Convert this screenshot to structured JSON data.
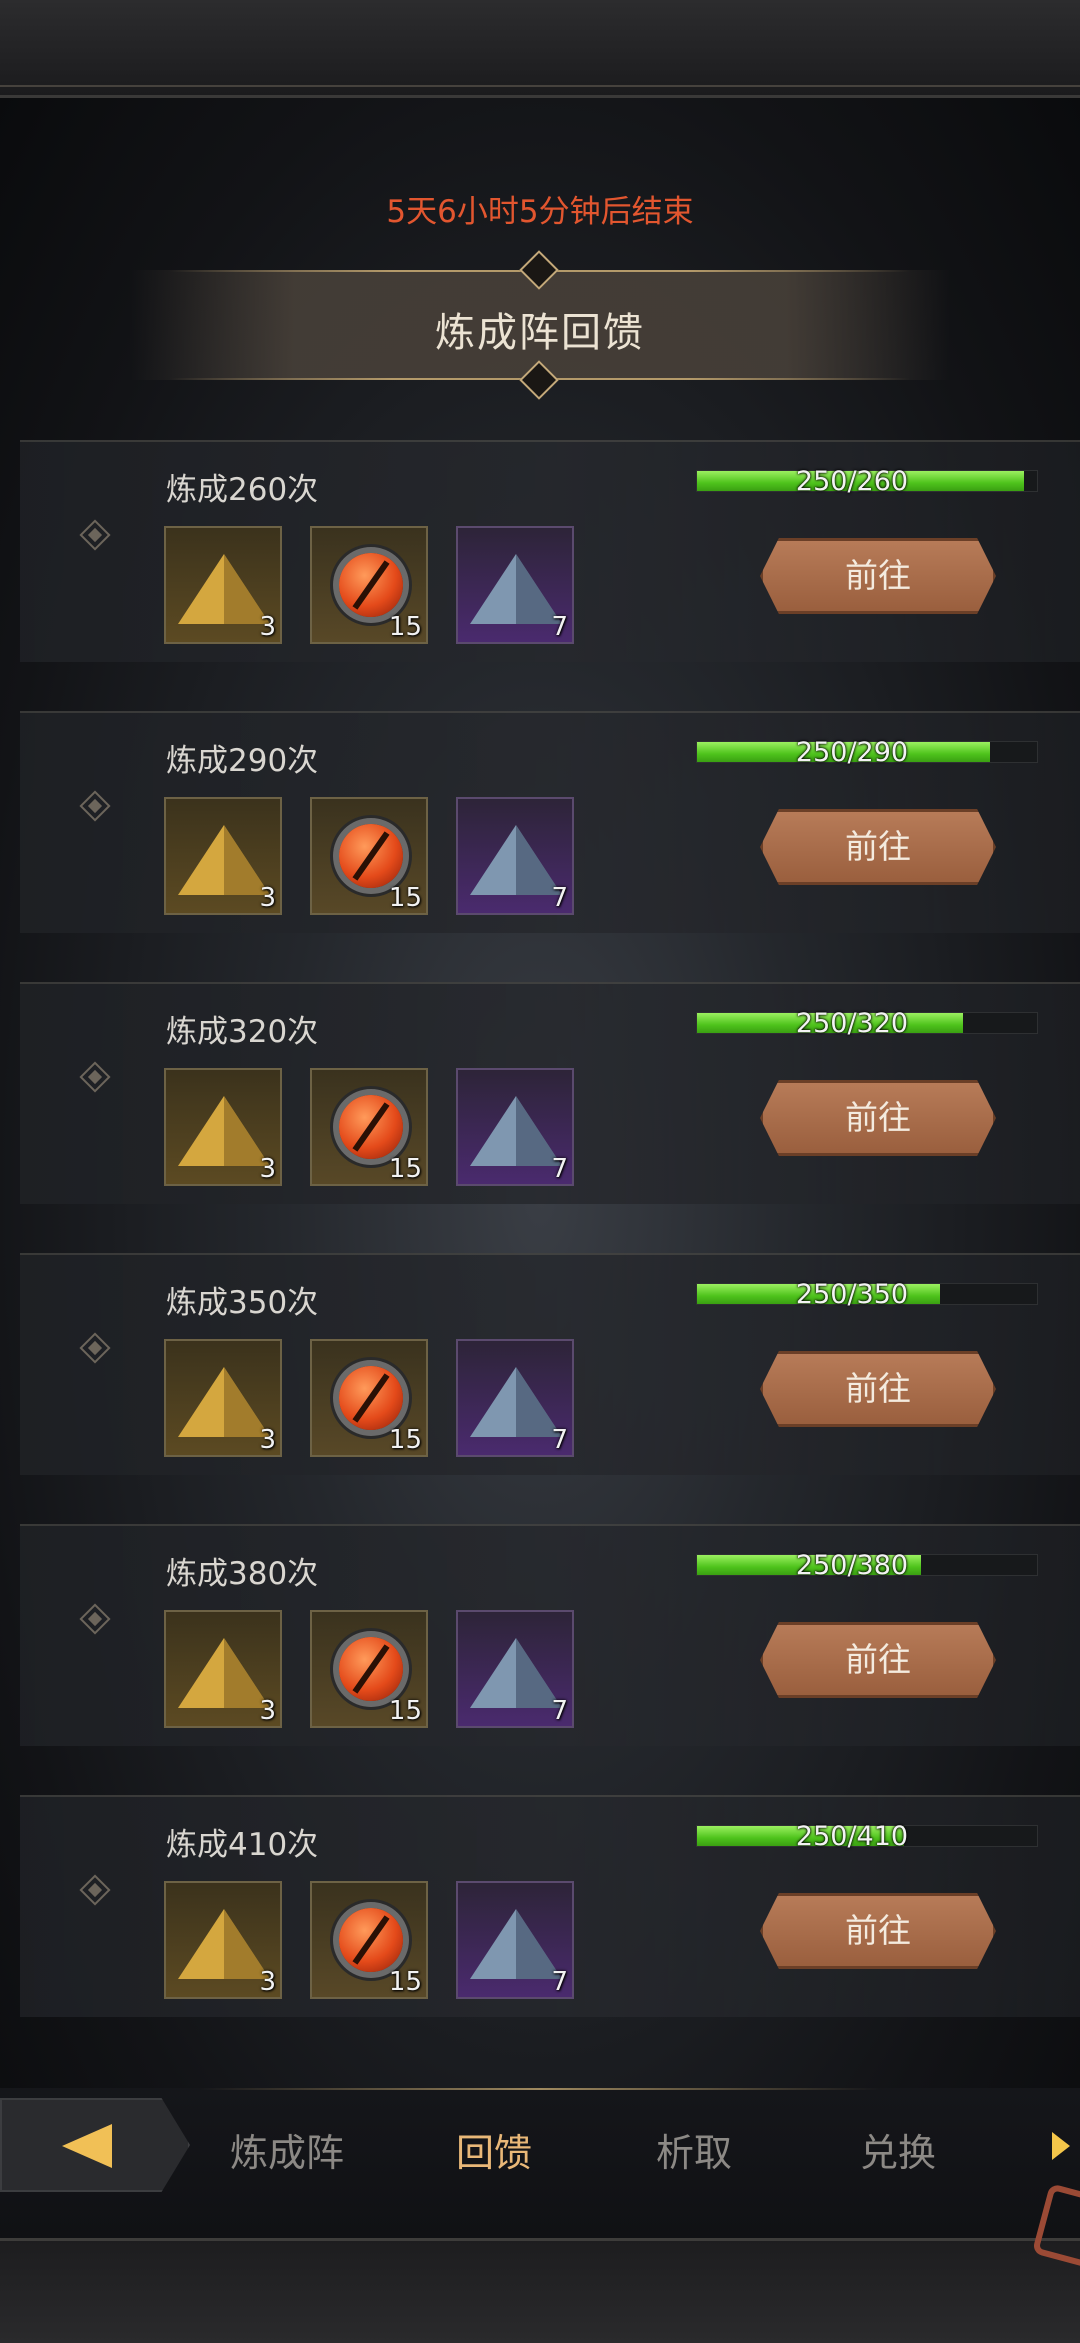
{
  "timer_text": "5天6小时5分钟后结束",
  "banner_title": "炼成阵回馈",
  "rows": [
    {
      "label": "炼成260次",
      "current": 250,
      "total": 260,
      "progress_text": "250/260",
      "button_label": "前往",
      "rewards": [
        {
          "type": "gold",
          "count": "3"
        },
        {
          "type": "red",
          "count": "15"
        },
        {
          "type": "purple",
          "count": "7"
        }
      ]
    },
    {
      "label": "炼成290次",
      "current": 250,
      "total": 290,
      "progress_text": "250/290",
      "button_label": "前往",
      "rewards": [
        {
          "type": "gold",
          "count": "3"
        },
        {
          "type": "red",
          "count": "15"
        },
        {
          "type": "purple",
          "count": "7"
        }
      ]
    },
    {
      "label": "炼成320次",
      "current": 250,
      "total": 320,
      "progress_text": "250/320",
      "button_label": "前往",
      "rewards": [
        {
          "type": "gold",
          "count": "3"
        },
        {
          "type": "red",
          "count": "15"
        },
        {
          "type": "purple",
          "count": "7"
        }
      ]
    },
    {
      "label": "炼成350次",
      "current": 250,
      "total": 350,
      "progress_text": "250/350",
      "button_label": "前往",
      "rewards": [
        {
          "type": "gold",
          "count": "3"
        },
        {
          "type": "red",
          "count": "15"
        },
        {
          "type": "purple",
          "count": "7"
        }
      ]
    },
    {
      "label": "炼成380次",
      "current": 250,
      "total": 380,
      "progress_text": "250/380",
      "button_label": "前往",
      "rewards": [
        {
          "type": "gold",
          "count": "3"
        },
        {
          "type": "red",
          "count": "15"
        },
        {
          "type": "purple",
          "count": "7"
        }
      ]
    },
    {
      "label": "炼成410次",
      "current": 250,
      "total": 410,
      "progress_text": "250/410",
      "button_label": "前往",
      "rewards": [
        {
          "type": "gold",
          "count": "3"
        },
        {
          "type": "red",
          "count": "15"
        },
        {
          "type": "purple",
          "count": "7"
        }
      ]
    }
  ],
  "tabs": [
    {
      "label": "炼成阵",
      "active": false
    },
    {
      "label": "回馈",
      "active": true
    },
    {
      "label": "析取",
      "active": false
    },
    {
      "label": "兑换",
      "active": false
    }
  ],
  "colors": {
    "timer": "#e2562f",
    "progress": "#4ec31c",
    "button": "#a8694a",
    "active_tab": "#e9b878"
  },
  "icons": {
    "back": "back-arrow-icon",
    "more": "chevron-right-icon",
    "reward_gold": "gold-pyramid-icon",
    "reward_red": "red-orb-icon",
    "reward_purple": "crystal-pyramid-icon"
  }
}
